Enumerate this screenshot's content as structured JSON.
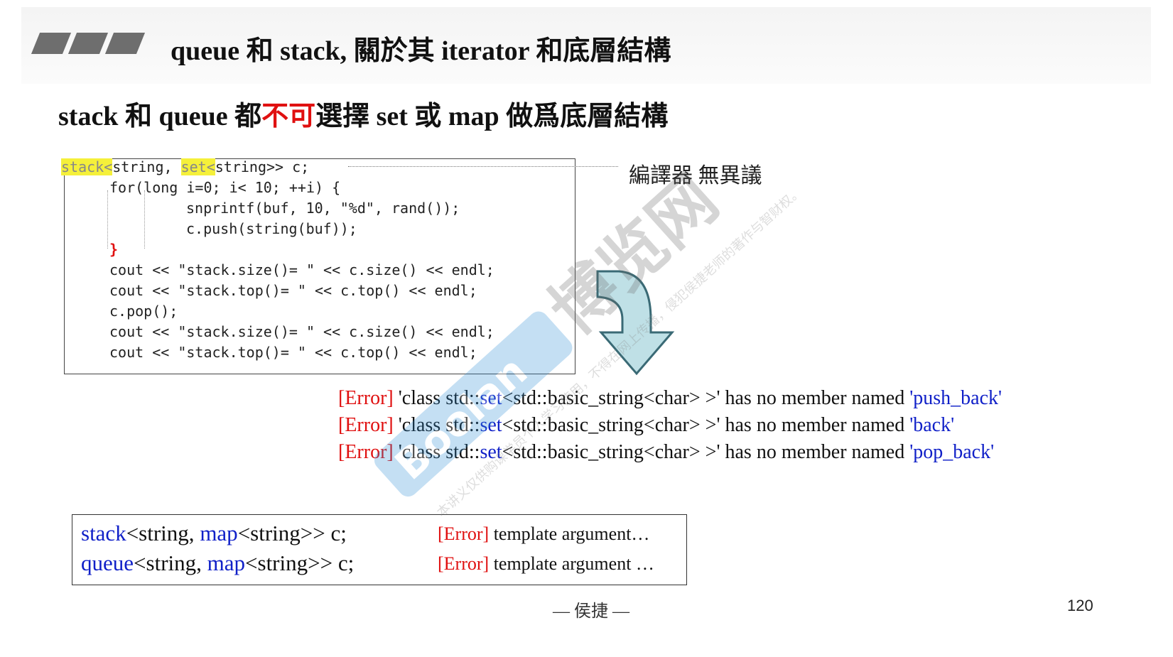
{
  "header": {
    "title": "queue 和 stack, 關於其 iterator 和底層結構"
  },
  "subtitle": {
    "part1": "stack 和 queue 都",
    "part2": "不可",
    "part3": "選擇 set 或 map 做爲底層結構"
  },
  "code": {
    "line1": {
      "a": "stack<",
      "b": "string, ",
      "c": "set<",
      "d": "string>> c;"
    },
    "line2": "for(long i=0; i< 10; ++i) {",
    "line3": "snprintf(buf, 10, \"%d\", rand());",
    "line4": "c.push(string(buf));",
    "line5": "}",
    "line6": "cout << \"stack.size()= \" << c.size() << endl;",
    "line7": "cout << \"stack.top()= \" << c.top() << endl;",
    "line8": "c.pop();",
    "line9": "cout << \"stack.size()= \" << c.size() << endl;",
    "line10": "cout << \"stack.top()= \" << c.top() << endl;"
  },
  "compiler_note": "編譯器 無異議",
  "errors": [
    {
      "tag": "[Error]",
      "pre": " 'class std::",
      "cls": "set",
      "mid": "<std::basic_string<char> >' has no member named ",
      "member": "'push_back'"
    },
    {
      "tag": "[Error]",
      "pre": " 'class std::",
      "cls": "set",
      "mid": "<std::basic_string<char> >' has no member named ",
      "member": "'back'"
    },
    {
      "tag": "[Error]",
      "pre": " 'class std::",
      "cls": "set",
      "mid": "<std::basic_string<char> >' has no member named ",
      "member": "'pop_back'"
    }
  ],
  "bottom_box": {
    "row1": {
      "container": "stack",
      "mid": "<string, ",
      "map": "map",
      "rest": "<string>> c;",
      "err_tag": "[Error]",
      "err_text": " template argument…"
    },
    "row2": {
      "container": "queue",
      "mid": "<string, ",
      "map": "map",
      "rest": "<string>> c;",
      "err_tag": "[Error]",
      "err_text": " template argument …"
    }
  },
  "footer": {
    "author": "— 侯捷 —",
    "page_number": "120"
  },
  "watermark": {
    "brand_cn": "博览网",
    "brand_en": "Boolan",
    "notice": "本讲义仅供购课学员个人学习使用，不得在网上传播，侵犯侯捷老师的著作与智财权。"
  },
  "colors": {
    "error_red": "#e01010",
    "keyword_blue": "#1020c8",
    "highlight_yellow": "#f5f03a",
    "arrow_fill": "#bfe0e6",
    "arrow_stroke": "#3a6a75"
  }
}
